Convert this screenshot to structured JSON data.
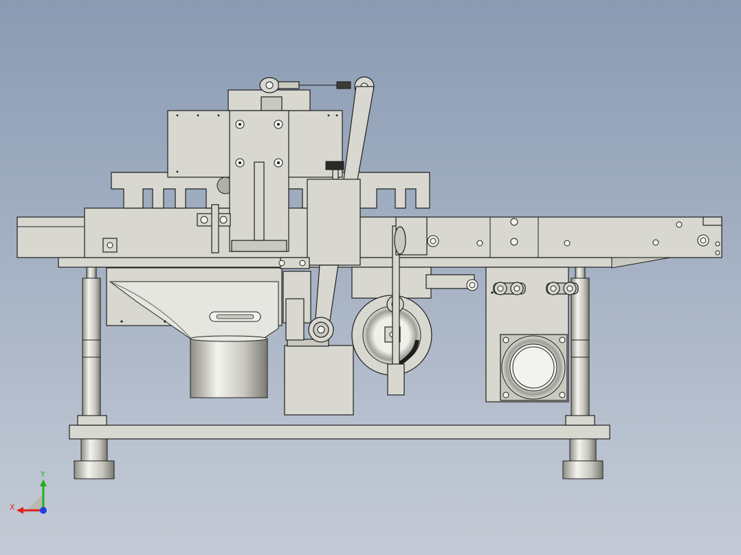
{
  "viewport": {
    "background_top": "#8a9bb3",
    "background_bottom": "#c4cbd6"
  },
  "model": {
    "part_fill": "#d8d8d0",
    "edge_color": "#1e1e1e"
  },
  "triad": {
    "x_label": "X",
    "y_label": "Y",
    "x_color": "#e02020",
    "y_color": "#20b020",
    "z_color": "#2040e0"
  }
}
